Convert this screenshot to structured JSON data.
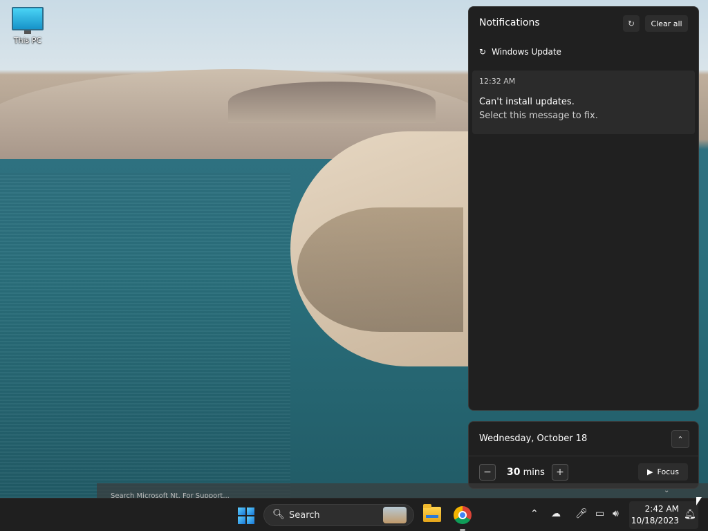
{
  "desktop": {
    "icon_label": "This PC"
  },
  "notifications": {
    "title": "Notifications",
    "dnd_icon": "bell-snooze-icon",
    "clear_all_label": "Clear all",
    "app_name": "Windows Update",
    "app_icon": "sync-icon",
    "card": {
      "time": "12:32 AM",
      "title": "Can't install updates.",
      "body": "Select this message to fix."
    }
  },
  "calendar": {
    "date": "Wednesday, October 18",
    "focus_value": "30",
    "focus_unit": "mins",
    "focus_label": "Focus"
  },
  "taskbar": {
    "search_placeholder": "Search",
    "clock_time": "2:42 AM",
    "clock_date": "10/18/2023",
    "suggestion_text": "Search Microsoft Nt. For Support..."
  }
}
